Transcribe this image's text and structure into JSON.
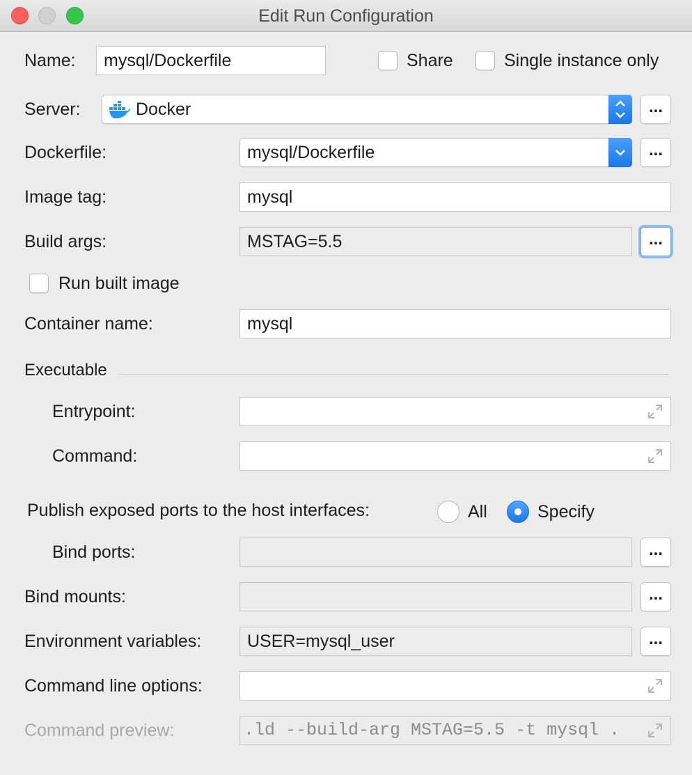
{
  "window": {
    "title": "Edit Run Configuration"
  },
  "name": {
    "label": "Name:",
    "value": "mysql/Dockerfile"
  },
  "share": {
    "label": "Share",
    "checked": false
  },
  "single_instance": {
    "label": "Single instance only",
    "checked": false
  },
  "server": {
    "label": "Server:",
    "value": "Docker",
    "icon": "docker-whale-icon"
  },
  "dockerfile": {
    "label": "Dockerfile:",
    "value": "mysql/Dockerfile"
  },
  "image_tag": {
    "label": "Image tag:",
    "value": "mysql"
  },
  "build_args": {
    "label": "Build args:",
    "value": "MSTAG=5.5"
  },
  "run_built_image": {
    "label": "Run built image",
    "checked": false
  },
  "container_name": {
    "label": "Container name:",
    "value": "mysql"
  },
  "executable": {
    "label": "Executable",
    "entrypoint": {
      "label": "Entrypoint:",
      "value": ""
    },
    "command": {
      "label": "Command:",
      "value": ""
    }
  },
  "publish": {
    "label": "Publish exposed ports to the host interfaces:",
    "options": [
      {
        "label": "All",
        "selected": false
      },
      {
        "label": "Specify",
        "selected": true
      }
    ]
  },
  "bind_ports": {
    "label": "Bind ports:",
    "value": ""
  },
  "bind_mounts": {
    "label": "Bind mounts:",
    "value": ""
  },
  "env_vars": {
    "label": "Environment variables:",
    "value": "USER=mysql_user"
  },
  "cmd_line_options": {
    "label": "Command line options:",
    "value": ""
  },
  "cmd_preview": {
    "label": "Command preview:",
    "value": ".ld --build-arg MSTAG=5.5 -t mysql ."
  },
  "browse_label": "...",
  "colors": {
    "accent": "#1a76e8",
    "focus_ring": "#8ebbf0",
    "disabled_text": "#a8a8a8"
  }
}
